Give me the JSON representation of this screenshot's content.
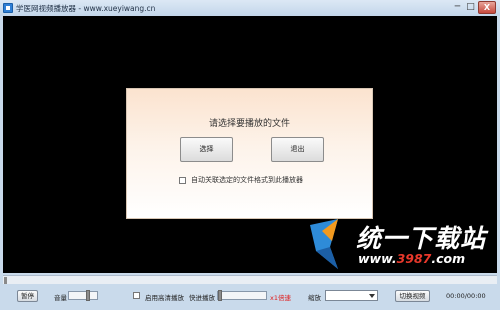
{
  "titlebar": {
    "title": "学医网视频播放器 - www.xueyiwang.cn",
    "minimize": "─",
    "maximize": "□",
    "close": "X"
  },
  "dialog": {
    "title": "请选择要播放的文件",
    "select_label": "选择",
    "exit_label": "退出",
    "checkbox_label": "自动关联选定的文件格式到此播放器",
    "checkbox_checked": false
  },
  "watermark": {
    "brand": "统一下载站",
    "url_prefix": "www.",
    "url_number": "3987",
    "url_suffix": ".com"
  },
  "controls": {
    "pause_label": "暂停",
    "volume_label": "音量",
    "volume_level": 0.7,
    "hd_checkbox_label": "启用高清播放",
    "hd_checked": false,
    "speed_label": "快进播放",
    "speed_value": "x1倍速",
    "speed_level": 0.0,
    "zoom_label": "缩放",
    "zoom_selected": "",
    "switch_label": "切换视频",
    "timecode": "00:00/00:00"
  },
  "seek": {
    "progress": 0.0
  },
  "colors": {
    "chrome": "#c9daeb",
    "video_bg": "#000000",
    "accent_red": "#e01b1b",
    "watermark_blue": "#2e8bd8"
  }
}
